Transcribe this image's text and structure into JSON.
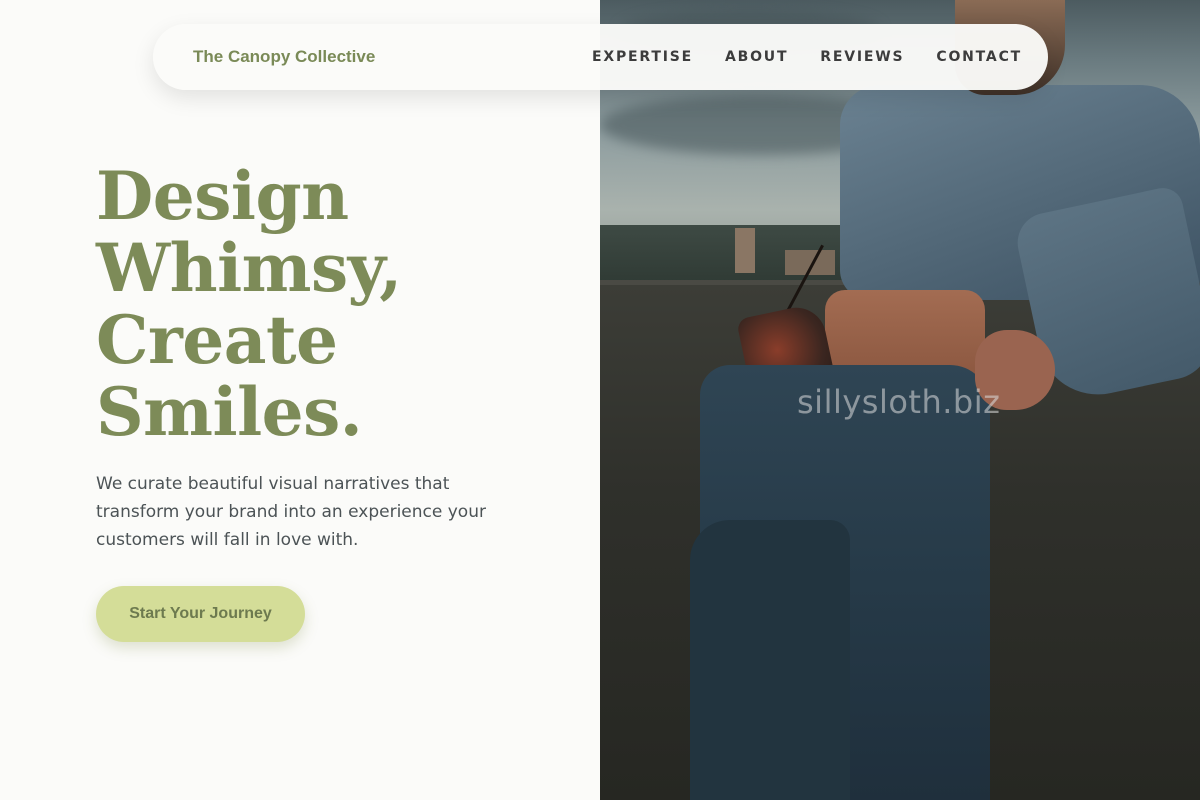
{
  "nav": {
    "brand": "The Canopy Collective",
    "links": [
      "EXPERTISE",
      "ABOUT",
      "REVIEWS",
      "CONTACT"
    ]
  },
  "hero": {
    "headline_lines": [
      "Design",
      "Whimsy,",
      "Create",
      "Smiles."
    ],
    "subtext": "We curate beautiful visual narratives that transform your brand into an experience your customers will fall in love with.",
    "cta_label": "Start Your Journey"
  },
  "image": {
    "watermark": "sillysloth.biz"
  },
  "colors": {
    "accent_green": "#7d8b58",
    "cta_background": "#d4dd98",
    "page_background": "#fbfbf9",
    "body_text": "#4c5356"
  }
}
